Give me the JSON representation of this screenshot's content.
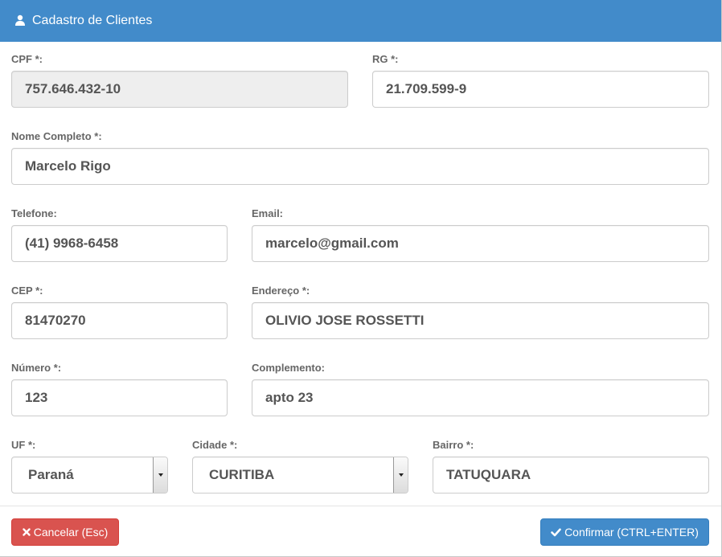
{
  "header": {
    "title": "Cadastro de Clientes",
    "icon": "user-icon"
  },
  "form": {
    "cpf": {
      "label": "CPF *:",
      "value": "757.646.432-10"
    },
    "rg": {
      "label": "RG *:",
      "value": "21.709.599-9"
    },
    "nome": {
      "label": "Nome Completo *:",
      "value": "Marcelo Rigo"
    },
    "telefone": {
      "label": "Telefone:",
      "value": "(41) 9968-6458"
    },
    "email": {
      "label": "Email:",
      "value": "marcelo@gmail.com"
    },
    "cep": {
      "label": "CEP *:",
      "value": "81470270"
    },
    "endereco": {
      "label": "Endereço *:",
      "value": "OLIVIO JOSE ROSSETTI"
    },
    "numero": {
      "label": "Número *:",
      "value": "123"
    },
    "complemento": {
      "label": "Complemento:",
      "value": "apto 23"
    },
    "uf": {
      "label": "UF *:",
      "value": "Paraná"
    },
    "cidade": {
      "label": "Cidade *:",
      "value": "CURITIBA"
    },
    "bairro": {
      "label": "Bairro *:",
      "value": "TATUQUARA"
    }
  },
  "footer": {
    "cancel_label": "Cancelar (Esc)",
    "confirm_label": "Confirmar (CTRL+ENTER)"
  },
  "colors": {
    "header": "#428bca",
    "cancel": "#d9534f",
    "confirm": "#428bca"
  }
}
